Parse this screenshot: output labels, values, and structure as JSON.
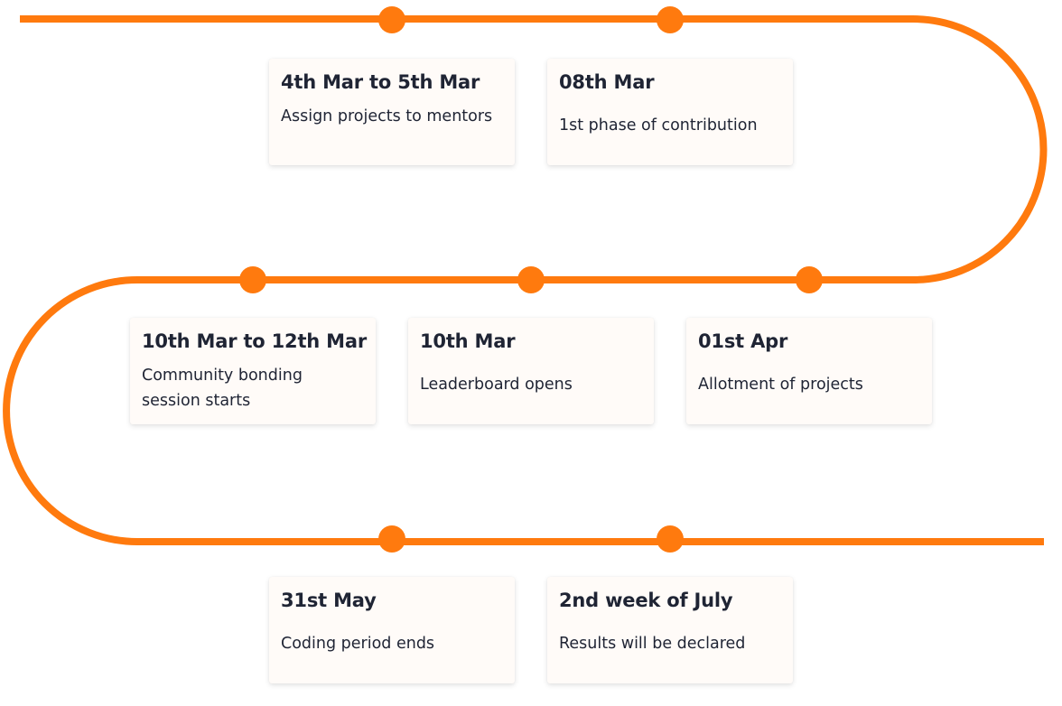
{
  "colors": {
    "path": "#ff7a0e",
    "card_background": "#fffbf8",
    "text": "#1f2434"
  },
  "events": [
    {
      "date": "4th Mar to 5th Mar",
      "description": "Assign projects to mentors"
    },
    {
      "date": "08th Mar",
      "description": "1st phase of contribution"
    },
    {
      "date": "10th Mar to 12th Mar",
      "description": "Community bonding session starts"
    },
    {
      "date": "10th Mar",
      "description": "Leaderboard opens"
    },
    {
      "date": "01st Apr",
      "description": "Allotment of projects"
    },
    {
      "date": "31st May",
      "description": "Coding period ends"
    },
    {
      "date": "2nd week of July",
      "description": "Results will be declared"
    }
  ]
}
